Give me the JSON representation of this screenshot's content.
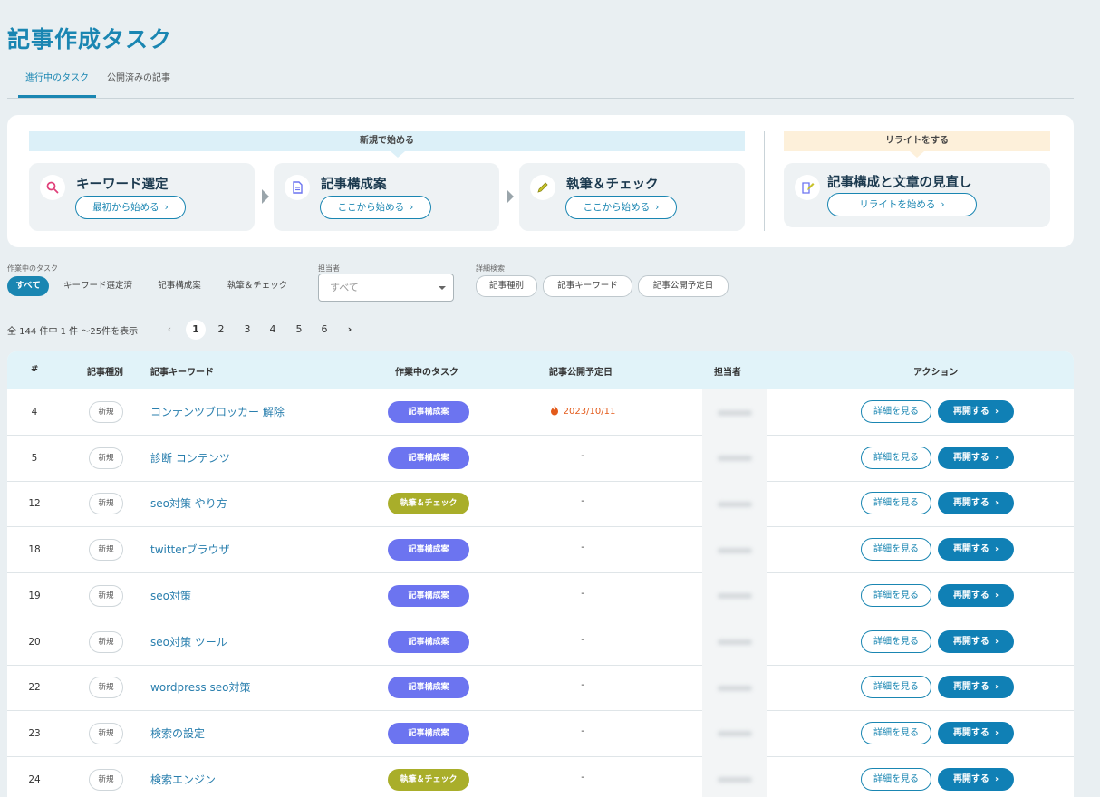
{
  "page": {
    "title": "記事作成タスク"
  },
  "tabs": [
    {
      "label": "進行中のタスク",
      "active": true
    },
    {
      "label": "公開済みの記事",
      "active": false
    }
  ],
  "start_panel": {
    "new_band": "新規で始める",
    "rewrite_band": "リライトをする",
    "cards": [
      {
        "title": "キーワード選定",
        "button": "最初から始める",
        "icon": "search-icon"
      },
      {
        "title": "記事構成案",
        "button": "ここから始める",
        "icon": "document-icon"
      },
      {
        "title": "執筆＆チェック",
        "button": "ここから始める",
        "icon": "pencil-icon"
      }
    ],
    "rewrite_card": {
      "title": "記事構成と文章の見直し",
      "button": "リライトを始める",
      "icon": "edit-document-icon"
    }
  },
  "filters": {
    "task_label": "作業中のタスク",
    "task_chips": [
      "すべて",
      "キーワード選定済",
      "記事構成案",
      "執筆＆チェック"
    ],
    "assignee_label": "担当者",
    "assignee_value": "すべて",
    "advanced_label": "詳細検索",
    "advanced_chips": [
      "記事種別",
      "記事キーワード",
      "記事公開予定日"
    ]
  },
  "pagination": {
    "summary": "全 144 件中 1 件 〜25件を表示",
    "prev": "‹",
    "pages": [
      "1",
      "2",
      "3",
      "4",
      "5",
      "6"
    ],
    "current": "1",
    "next": "›"
  },
  "table": {
    "headers": [
      "#",
      "記事種別",
      "記事キーワード",
      "作業中のタスク",
      "記事公開予定日",
      "担当者",
      "アクション"
    ],
    "detail_label": "詳細を見る",
    "resume_label": "再開する",
    "rows": [
      {
        "id": "4",
        "type": "新規",
        "keyword": "コンテンツブロッカー 解除",
        "task": "記事構成案",
        "date": "2023/10/11",
        "hot": true
      },
      {
        "id": "5",
        "type": "新規",
        "keyword": "診断 コンテンツ",
        "task": "記事構成案",
        "date": "-",
        "hot": false
      },
      {
        "id": "12",
        "type": "新規",
        "keyword": "seo対策 やり方",
        "task": "執筆＆チェック",
        "date": "-",
        "hot": false
      },
      {
        "id": "18",
        "type": "新規",
        "keyword": "twitterブラウザ",
        "task": "記事構成案",
        "date": "-",
        "hot": false
      },
      {
        "id": "19",
        "type": "新規",
        "keyword": "seo対策",
        "task": "記事構成案",
        "date": "-",
        "hot": false
      },
      {
        "id": "20",
        "type": "新規",
        "keyword": "seo対策 ツール",
        "task": "記事構成案",
        "date": "-",
        "hot": false
      },
      {
        "id": "22",
        "type": "新規",
        "keyword": "wordpress seo対策",
        "task": "記事構成案",
        "date": "-",
        "hot": false
      },
      {
        "id": "23",
        "type": "新規",
        "keyword": "検索の設定",
        "task": "記事構成案",
        "date": "-",
        "hot": false
      },
      {
        "id": "24",
        "type": "新規",
        "keyword": "検索エンジン",
        "task": "執筆＆チェック",
        "date": "-",
        "hot": false
      }
    ]
  },
  "colors": {
    "accent": "#1a86b2",
    "task_outline": "#6c74f0",
    "task_writing": "#a9ae2a",
    "hot_date": "#e35b1b"
  }
}
